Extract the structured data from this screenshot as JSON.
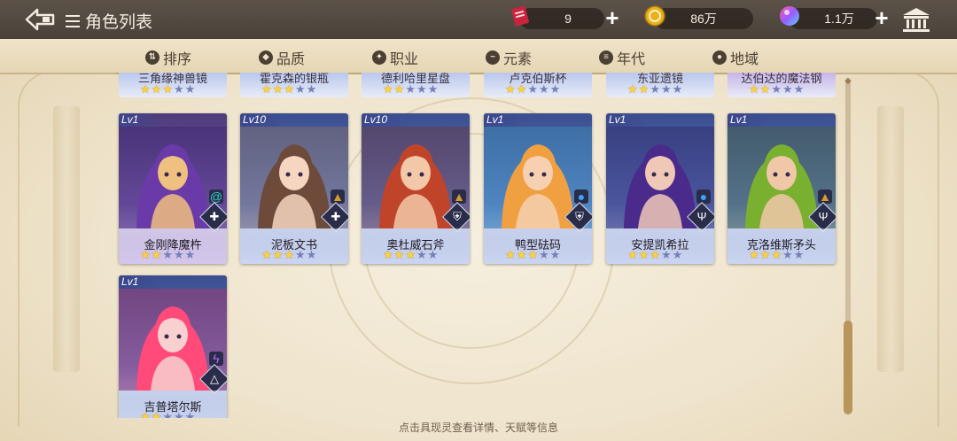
{
  "header": {
    "title": "角色列表",
    "tickets": "9",
    "coins": "86万",
    "gems": "1.1万"
  },
  "tabs": [
    {
      "label": "排序",
      "icon": "sort-icon"
    },
    {
      "label": "品质",
      "icon": "quality-icon"
    },
    {
      "label": "职业",
      "icon": "class-icon"
    },
    {
      "label": "元素",
      "icon": "element-icon"
    },
    {
      "label": "年代",
      "icon": "era-icon"
    },
    {
      "label": "地域",
      "icon": "region-icon"
    }
  ],
  "partial_row": [
    {
      "name": "三角缘神兽镜",
      "stars": 3
    },
    {
      "name": "霍克森的银瓶",
      "stars": 3
    },
    {
      "name": "德利哈里星盘",
      "stars": 2
    },
    {
      "name": "卢克伯斯杯",
      "stars": 2
    },
    {
      "name": "东亚遗镜",
      "stars": 2
    },
    {
      "name": "达伯达的魔法钢",
      "stars": 2
    }
  ],
  "cards": [
    {
      "name": "金刚降魔杵",
      "level": "Lv1",
      "stars": 2,
      "element": "swirl-icon",
      "class": "cross-icon",
      "theme": "purple"
    },
    {
      "name": "泥板文书",
      "level": "Lv10",
      "stars": 3,
      "element": "mountain-icon",
      "class": "cross-icon",
      "theme": "blue"
    },
    {
      "name": "奥杜威石斧",
      "level": "Lv10",
      "stars": 3,
      "element": "mountain-icon",
      "class": "shield-icon",
      "theme": "blue"
    },
    {
      "name": "鸭型砝码",
      "level": "Lv1",
      "stars": 3,
      "element": "water-drop-icon",
      "class": "shield-icon",
      "theme": "blue"
    },
    {
      "name": "安提凯希拉",
      "level": "Lv1",
      "stars": 3,
      "element": "water-drop-icon",
      "class": "trident-icon",
      "theme": "blue"
    },
    {
      "name": "克洛维斯矛头",
      "level": "Lv1",
      "stars": 3,
      "element": "mountain-icon",
      "class": "trident-icon",
      "theme": "blue"
    },
    {
      "name": "吉普塔尔斯",
      "level": "Lv1",
      "stars": 2,
      "element": "lightning-icon",
      "class": "triangle-icon",
      "theme": "blue"
    }
  ],
  "hint": "点击具现灵查看详情、天赋等信息",
  "colors": {
    "star_on": "#ffd23a",
    "star_off": "#7580b8",
    "header_bg": "#4a423a"
  }
}
